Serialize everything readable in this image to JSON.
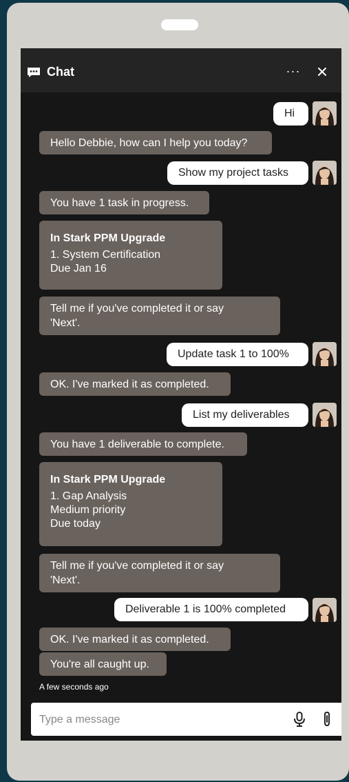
{
  "header": {
    "title": "Chat",
    "more_label": "···",
    "icon": "chat-bubble-icon",
    "close_icon": "close-icon"
  },
  "messages": {
    "u1": "Hi",
    "b1": "Hello Debbie, how can I help you today?",
    "u2": "Show my project tasks",
    "b2": "You have 1 task in progress.",
    "card1": {
      "title": "In Stark PPM Upgrade",
      "line1": "1. System Certification",
      "line2": "Due Jan 16"
    },
    "b3_line1": "Tell me if you've completed it or say",
    "b3_line2": "'Next'.",
    "u3": "Update task 1 to 100%",
    "b4": "OK. I've marked it as completed.",
    "u4": "List my deliverables",
    "b5": "You have 1 deliverable to complete.",
    "card2": {
      "title": "In Stark PPM Upgrade",
      "line1": "1. Gap Analysis",
      "line2": "Medium priority",
      "line3": "Due today"
    },
    "b6_line1": "Tell me if you've completed it or say",
    "b6_line2": "'Next'.",
    "u5": "Deliverable 1 is 100% completed",
    "b7": "OK. I've marked it as completed.",
    "b8": "You're all caught up."
  },
  "timestamp": "A few seconds ago",
  "composer": {
    "placeholder": "Type a message",
    "mic_icon": "microphone-icon",
    "attach_icon": "paperclip-icon"
  },
  "colors": {
    "bot_bubble": "#6a625d",
    "user_bubble": "#ffffff",
    "chat_bg": "#161616",
    "header_bg": "#242424",
    "page_bg": "#0e3848",
    "device": "#d3d1cc"
  }
}
